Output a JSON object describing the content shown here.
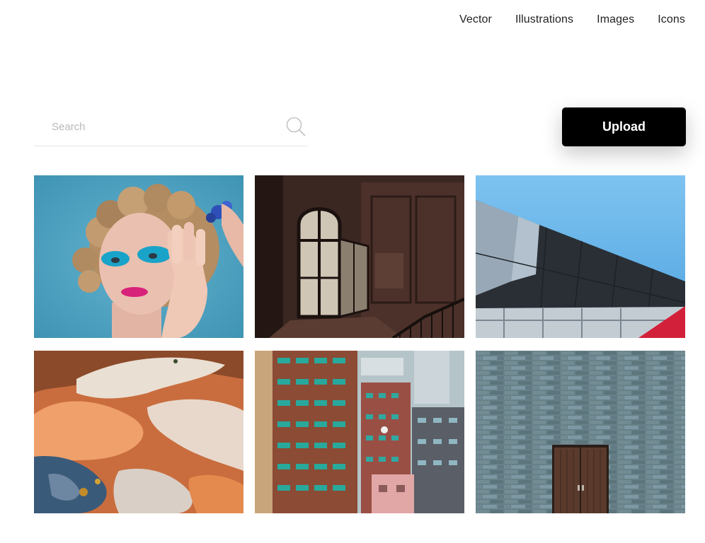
{
  "nav": {
    "items": [
      {
        "label": "Vector"
      },
      {
        "label": "Illustrations"
      },
      {
        "label": "Images"
      },
      {
        "label": "Icons"
      }
    ]
  },
  "search": {
    "placeholder": "Search",
    "value": "",
    "icon": "search-icon"
  },
  "upload": {
    "label": "Upload"
  },
  "gallery": {
    "images": [
      {
        "subject": "portrait-blue-eyeshadow"
      },
      {
        "subject": "dark-room-arched-window"
      },
      {
        "subject": "modern-roof-blue-sky"
      },
      {
        "subject": "aerial-abstract-terrain"
      },
      {
        "subject": "high-rise-apartment-buildings"
      },
      {
        "subject": "stone-wall-wooden-door"
      }
    ]
  }
}
